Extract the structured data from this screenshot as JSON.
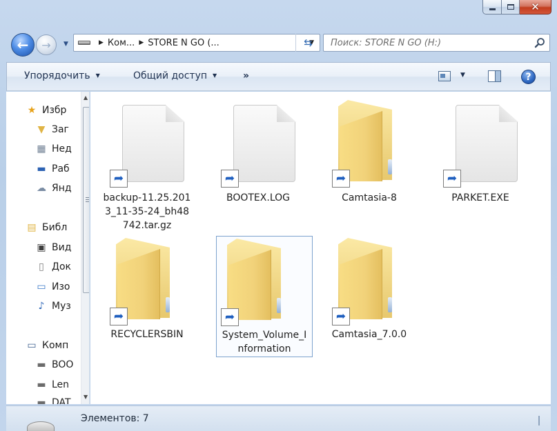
{
  "window": {
    "caption_minimize": "",
    "caption_maximize": "",
    "caption_close": "✕"
  },
  "nav": {
    "back_label": "←",
    "forward_label": "→",
    "breadcrumbs": [
      "Ком...",
      "STORE N GO (..."
    ],
    "search_placeholder": "Поиск: STORE N GO (H:)"
  },
  "toolbar": {
    "organize_label": "Упорядочить",
    "share_label": "Общий доступ",
    "more_label": "»",
    "help_label": "?"
  },
  "navpane": {
    "items": [
      {
        "label": "Избр",
        "icon": "star-icon"
      },
      {
        "label": "Заг",
        "icon": "downloads-icon"
      },
      {
        "label": "Нед",
        "icon": "recent-places-icon"
      },
      {
        "label": "Раб",
        "icon": "desktop-icon"
      },
      {
        "label": "Янд",
        "icon": "yandex-disk-icon"
      },
      {
        "label": "Библ",
        "icon": "libraries-icon"
      },
      {
        "label": "Вид",
        "icon": "video-icon"
      },
      {
        "label": "Док",
        "icon": "documents-icon"
      },
      {
        "label": "Изо",
        "icon": "pictures-icon"
      },
      {
        "label": "Муз",
        "icon": "music-icon"
      },
      {
        "label": "Комп",
        "icon": "computer-icon"
      },
      {
        "label": "BOO",
        "icon": "drive-icon"
      },
      {
        "label": "Len",
        "icon": "drive-icon"
      },
      {
        "label": "DAT",
        "icon": "drive-icon"
      }
    ]
  },
  "files": [
    {
      "name": "backup-11.25.201\n3_11-35-24_bh48\n742.tar.gz",
      "lines": [
        "backup-11.25.201",
        "3_11-35-24_bh48",
        "742.tar.gz"
      ],
      "type": "file"
    },
    {
      "name": "BOOTEX.LOG",
      "lines": [
        "BOOTEX.LOG"
      ],
      "type": "file"
    },
    {
      "name": "Camtasia-8",
      "lines": [
        "Camtasia-8"
      ],
      "type": "folder"
    },
    {
      "name": "PARKET.EXE",
      "lines": [
        "PARKET.EXE"
      ],
      "type": "file"
    },
    {
      "name": "RECYCLERSBIN",
      "lines": [
        "RECYCLERSBIN"
      ],
      "type": "folder"
    },
    {
      "name": "System_Volume_Information",
      "lines": [
        "System_Volume_I",
        "nformation"
      ],
      "type": "folder",
      "selected": true
    },
    {
      "name": "Camtasia_7.0.0",
      "lines": [
        "Camtasia_7.0.0"
      ],
      "type": "folder"
    }
  ],
  "status": {
    "item_count_text": "Элементов: 7"
  },
  "colors": {
    "selection_border": "#7da2ce",
    "shortcut_arrow": "#1f5fbf",
    "folder": "#f1d27a"
  }
}
